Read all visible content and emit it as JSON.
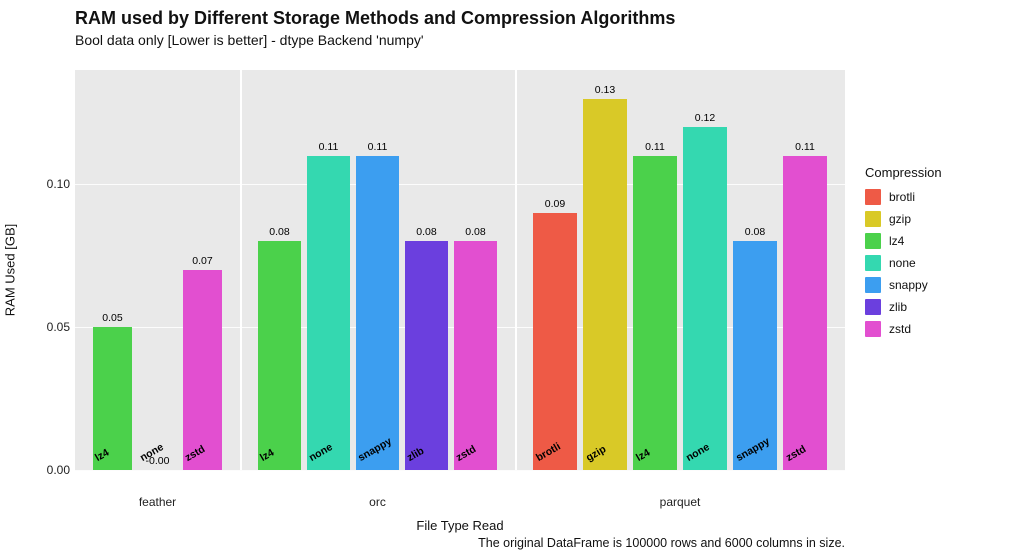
{
  "chart_data": {
    "type": "bar",
    "title": "RAM used by Different Storage Methods and Compression Algorithms",
    "subtitle": "Bool data only [Lower is better] - dtype Backend 'numpy'",
    "xlabel": "File Type Read",
    "ylabel": "RAM Used [GB]",
    "ylim": [
      0,
      0.14
    ],
    "yticks": [
      0.0,
      0.05,
      0.1
    ],
    "footnote": "The original DataFrame is 100000 rows and 6000 columns in size.",
    "legend_title": "Compression",
    "compression_colors": {
      "brotli": "#ee5a46",
      "gzip": "#d9c927",
      "lz4": "#4bd14b",
      "none": "#34d8b0",
      "snappy": "#3c9ef0",
      "zlib": "#6b3fde",
      "zstd": "#e24fd0"
    },
    "facets": [
      {
        "name": "feather",
        "bars": [
          {
            "compression": "lz4",
            "value": 0.05,
            "label": "0.05"
          },
          {
            "compression": "none",
            "value": -0.0,
            "label": "-0.00"
          },
          {
            "compression": "zstd",
            "value": 0.07,
            "label": "0.07"
          }
        ]
      },
      {
        "name": "orc",
        "bars": [
          {
            "compression": "lz4",
            "value": 0.08,
            "label": "0.08"
          },
          {
            "compression": "none",
            "value": 0.11,
            "label": "0.11"
          },
          {
            "compression": "snappy",
            "value": 0.11,
            "label": "0.11"
          },
          {
            "compression": "zlib",
            "value": 0.08,
            "label": "0.08"
          },
          {
            "compression": "zstd",
            "value": 0.08,
            "label": "0.08"
          }
        ]
      },
      {
        "name": "parquet",
        "bars": [
          {
            "compression": "brotli",
            "value": 0.09,
            "label": "0.09"
          },
          {
            "compression": "gzip",
            "value": 0.13,
            "label": "0.13"
          },
          {
            "compression": "lz4",
            "value": 0.11,
            "label": "0.11"
          },
          {
            "compression": "none",
            "value": 0.12,
            "label": "0.12"
          },
          {
            "compression": "snappy",
            "value": 0.08,
            "label": "0.08"
          },
          {
            "compression": "zstd",
            "value": 0.11,
            "label": "0.11"
          }
        ]
      }
    ]
  }
}
